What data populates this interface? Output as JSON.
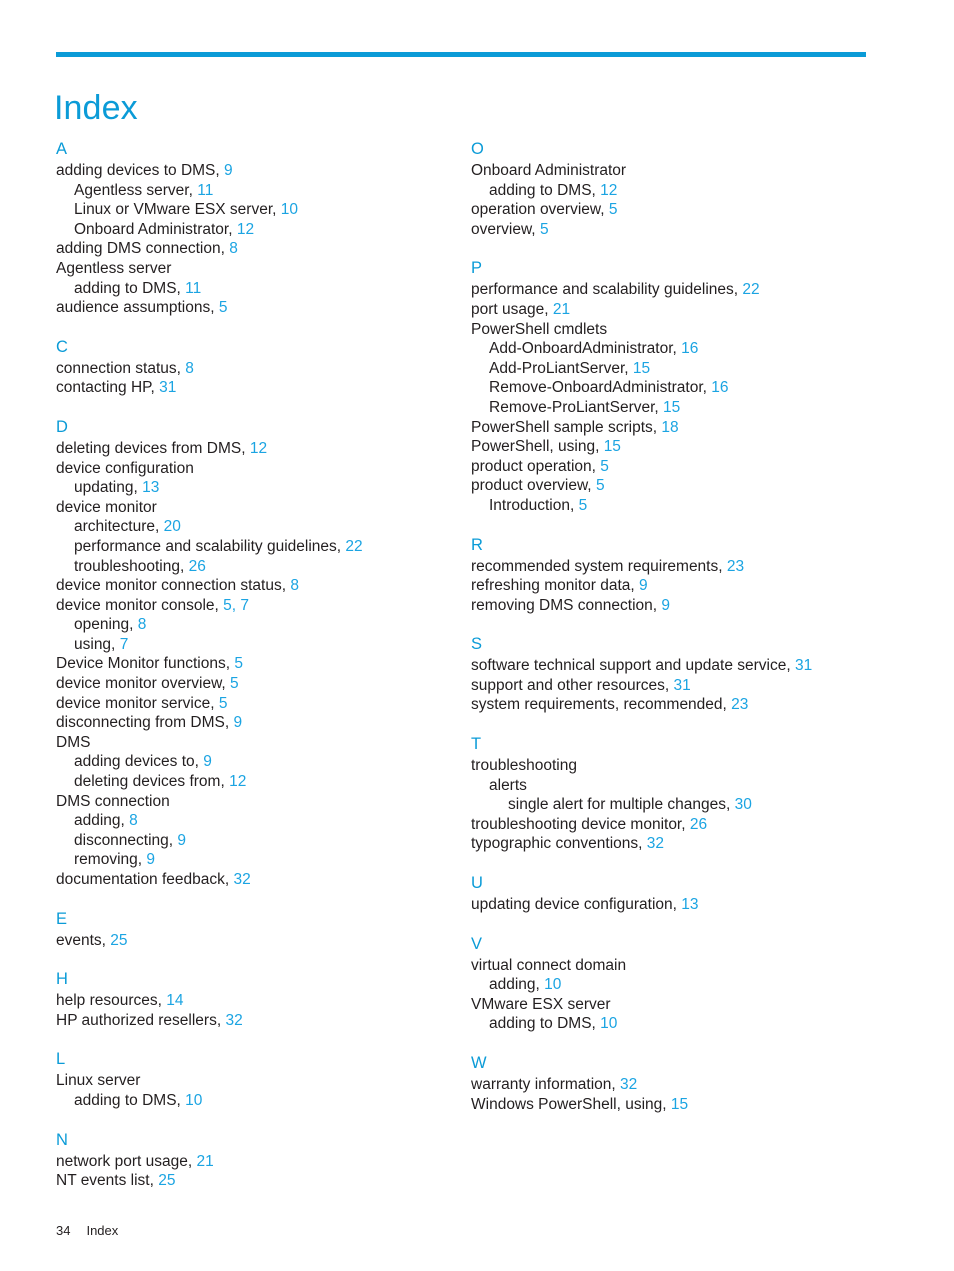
{
  "document": {
    "title": "Index",
    "accent_color": "#0b9bd7",
    "page_number_color": "#1ba4e2",
    "text_color": "#231f20"
  },
  "footer": {
    "page_number": "34",
    "label": "Index"
  },
  "columns": [
    {
      "id": "left",
      "sections": [
        {
          "letter": "A",
          "entries": [
            {
              "level": 1,
              "text": "adding devices to DMS,",
              "pages": "9"
            },
            {
              "level": 2,
              "text": "Agentless server,",
              "pages": "11"
            },
            {
              "level": 2,
              "text": "Linux or VMware ESX server,",
              "pages": "10"
            },
            {
              "level": 2,
              "text": "Onboard Administrator,",
              "pages": "12"
            },
            {
              "level": 1,
              "text": "adding DMS connection,",
              "pages": "8"
            },
            {
              "level": 1,
              "text": "Agentless server",
              "pages": ""
            },
            {
              "level": 2,
              "text": "adding to DMS,",
              "pages": "11"
            },
            {
              "level": 1,
              "text": "audience assumptions,",
              "pages": "5"
            }
          ]
        },
        {
          "letter": "C",
          "entries": [
            {
              "level": 1,
              "text": "connection status,",
              "pages": "8"
            },
            {
              "level": 1,
              "text": "contacting HP,",
              "pages": "31"
            }
          ]
        },
        {
          "letter": "D",
          "entries": [
            {
              "level": 1,
              "text": "deleting devices from DMS,",
              "pages": "12"
            },
            {
              "level": 1,
              "text": "device configuration",
              "pages": ""
            },
            {
              "level": 2,
              "text": "updating,",
              "pages": "13"
            },
            {
              "level": 1,
              "text": "device monitor",
              "pages": ""
            },
            {
              "level": 2,
              "text": "architecture,",
              "pages": "20"
            },
            {
              "level": 2,
              "text": "performance and scalability guidelines,",
              "pages": "22"
            },
            {
              "level": 2,
              "text": "troubleshooting,",
              "pages": "26"
            },
            {
              "level": 1,
              "text": "device monitor connection status,",
              "pages": "8"
            },
            {
              "level": 1,
              "text": "device monitor console,",
              "pages": "5, 7"
            },
            {
              "level": 2,
              "text": "opening,",
              "pages": "8"
            },
            {
              "level": 2,
              "text": "using,",
              "pages": "7"
            },
            {
              "level": 1,
              "text": "Device Monitor functions,",
              "pages": "5"
            },
            {
              "level": 1,
              "text": "device monitor overview,",
              "pages": "5"
            },
            {
              "level": 1,
              "text": "device monitor service,",
              "pages": "5"
            },
            {
              "level": 1,
              "text": "disconnecting from DMS,",
              "pages": "9"
            },
            {
              "level": 1,
              "text": "DMS",
              "pages": ""
            },
            {
              "level": 2,
              "text": "adding devices to,",
              "pages": "9"
            },
            {
              "level": 2,
              "text": "deleting devices from,",
              "pages": "12"
            },
            {
              "level": 1,
              "text": "DMS connection",
              "pages": ""
            },
            {
              "level": 2,
              "text": "adding,",
              "pages": "8"
            },
            {
              "level": 2,
              "text": "disconnecting,",
              "pages": "9"
            },
            {
              "level": 2,
              "text": "removing,",
              "pages": "9"
            },
            {
              "level": 1,
              "text": "documentation feedback,",
              "pages": "32"
            }
          ]
        },
        {
          "letter": "E",
          "entries": [
            {
              "level": 1,
              "text": "events,",
              "pages": "25"
            }
          ]
        },
        {
          "letter": "H",
          "entries": [
            {
              "level": 1,
              "text": "help resources,",
              "pages": "14"
            },
            {
              "level": 1,
              "text": "HP authorized resellers,",
              "pages": "32"
            }
          ]
        },
        {
          "letter": "L",
          "entries": [
            {
              "level": 1,
              "text": "Linux server",
              "pages": ""
            },
            {
              "level": 2,
              "text": "adding to DMS,",
              "pages": "10"
            }
          ]
        },
        {
          "letter": "N",
          "entries": [
            {
              "level": 1,
              "text": "network port usage,",
              "pages": "21"
            },
            {
              "level": 1,
              "text": "NT events list,",
              "pages": "25"
            }
          ]
        }
      ]
    },
    {
      "id": "right",
      "sections": [
        {
          "letter": "O",
          "entries": [
            {
              "level": 1,
              "text": "Onboard Administrator",
              "pages": ""
            },
            {
              "level": 2,
              "text": "adding to DMS,",
              "pages": "12"
            },
            {
              "level": 1,
              "text": "operation overview,",
              "pages": "5"
            },
            {
              "level": 1,
              "text": "overview,",
              "pages": "5"
            }
          ]
        },
        {
          "letter": "P",
          "entries": [
            {
              "level": 1,
              "text": "performance and scalability guidelines,",
              "pages": "22"
            },
            {
              "level": 1,
              "text": "port usage,",
              "pages": "21"
            },
            {
              "level": 1,
              "text": "PowerShell cmdlets",
              "pages": ""
            },
            {
              "level": 2,
              "text": "Add-OnboardAdministrator,",
              "pages": "16"
            },
            {
              "level": 2,
              "text": "Add-ProLiantServer,",
              "pages": "15"
            },
            {
              "level": 2,
              "text": "Remove-OnboardAdministrator,",
              "pages": "16"
            },
            {
              "level": 2,
              "text": "Remove-ProLiantServer,",
              "pages": "15"
            },
            {
              "level": 1,
              "text": "PowerShell sample scripts,",
              "pages": "18"
            },
            {
              "level": 1,
              "text": "PowerShell, using,",
              "pages": "15"
            },
            {
              "level": 1,
              "text": "product operation,",
              "pages": "5"
            },
            {
              "level": 1,
              "text": "product overview,",
              "pages": "5"
            },
            {
              "level": 2,
              "text": "Introduction,",
              "pages": "5"
            }
          ]
        },
        {
          "letter": "R",
          "entries": [
            {
              "level": 1,
              "text": "recommended system requirements,",
              "pages": "23"
            },
            {
              "level": 1,
              "text": "refreshing monitor data,",
              "pages": "9"
            },
            {
              "level": 1,
              "text": "removing DMS connection,",
              "pages": "9"
            }
          ]
        },
        {
          "letter": "S",
          "entries": [
            {
              "level": 1,
              "text": "software technical support and update service,",
              "pages": "31"
            },
            {
              "level": 1,
              "text": "support and other resources,",
              "pages": "31"
            },
            {
              "level": 1,
              "text": "system requirements, recommended,",
              "pages": "23"
            }
          ]
        },
        {
          "letter": "T",
          "entries": [
            {
              "level": 1,
              "text": "troubleshooting",
              "pages": ""
            },
            {
              "level": 2,
              "text": "alerts",
              "pages": ""
            },
            {
              "level": 3,
              "text": "single alert for multiple changes,",
              "pages": "30"
            },
            {
              "level": 1,
              "text": "troubleshooting device monitor,",
              "pages": "26"
            },
            {
              "level": 1,
              "text": "typographic conventions,",
              "pages": "32"
            }
          ]
        },
        {
          "letter": "U",
          "entries": [
            {
              "level": 1,
              "text": "updating device configuration,",
              "pages": "13"
            }
          ]
        },
        {
          "letter": "V",
          "entries": [
            {
              "level": 1,
              "text": "virtual connect domain",
              "pages": ""
            },
            {
              "level": 2,
              "text": "adding,",
              "pages": "10"
            },
            {
              "level": 1,
              "text": "VMware ESX server",
              "pages": ""
            },
            {
              "level": 2,
              "text": "adding to DMS,",
              "pages": "10"
            }
          ]
        },
        {
          "letter": "W",
          "entries": [
            {
              "level": 1,
              "text": "warranty information,",
              "pages": "32"
            },
            {
              "level": 1,
              "text": "Windows PowerShell, using,",
              "pages": "15"
            }
          ]
        }
      ]
    }
  ]
}
